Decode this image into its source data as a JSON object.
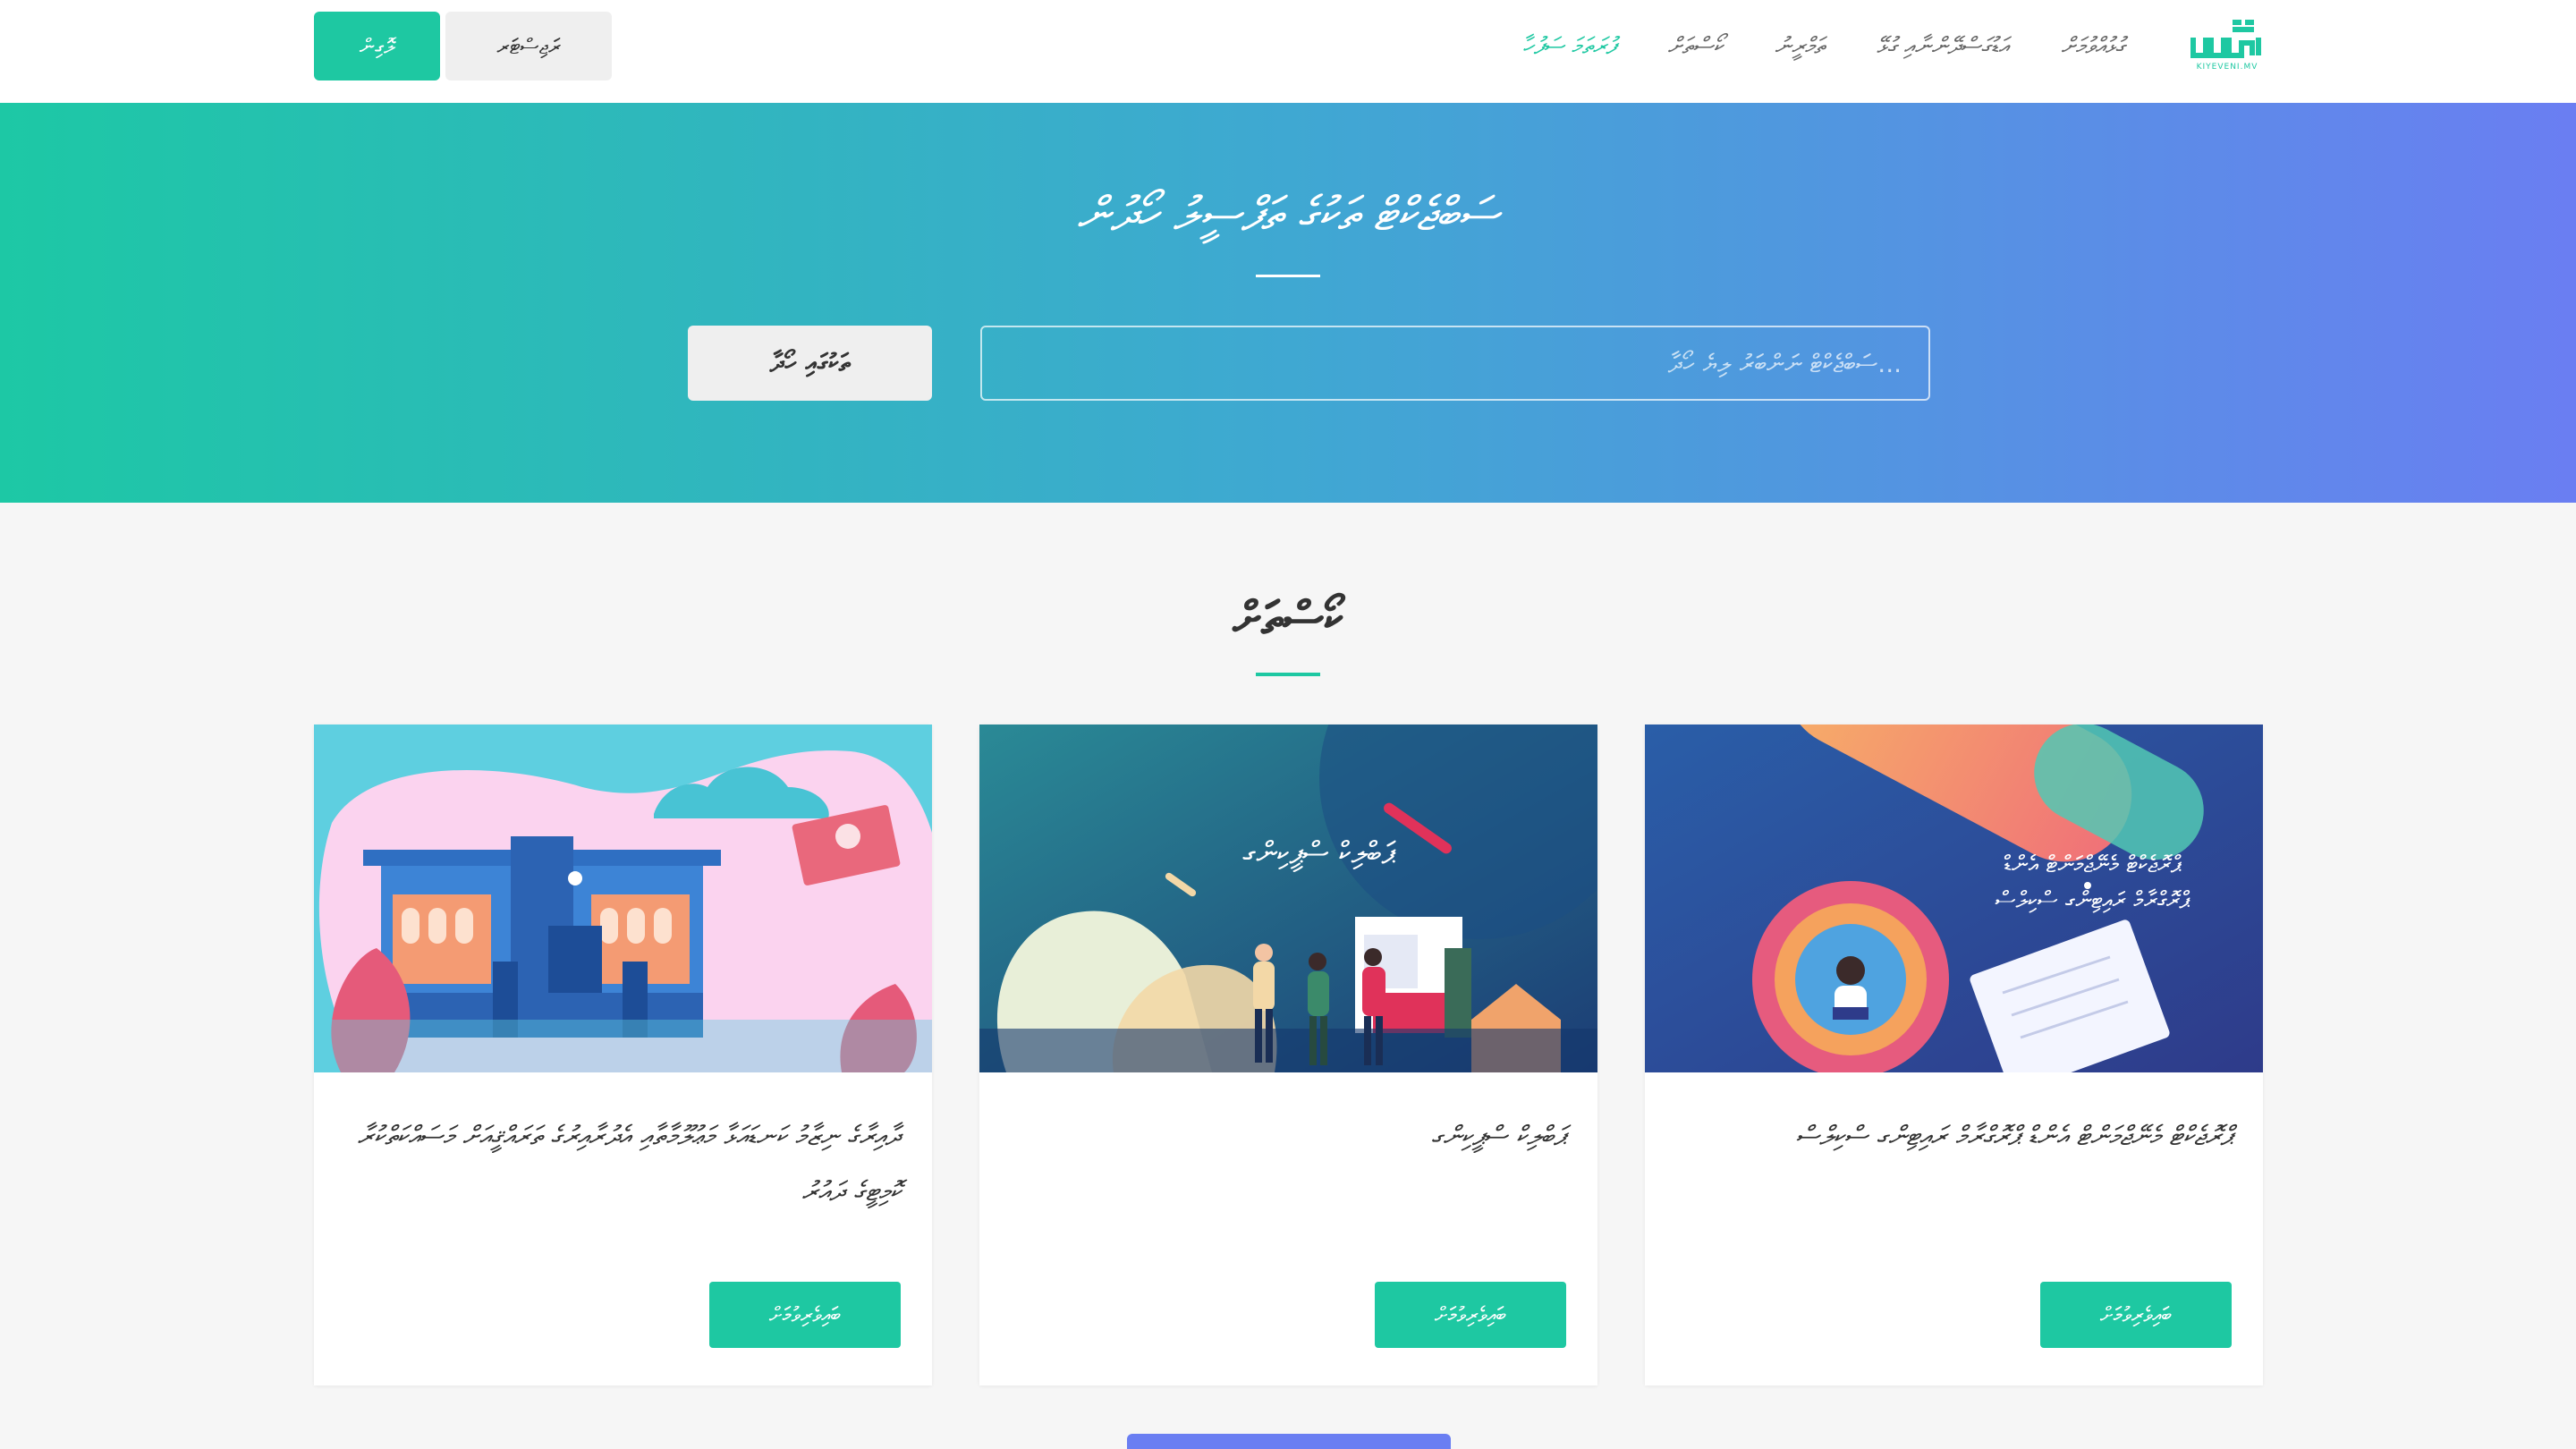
{
  "site": {
    "logo_text": "KIYEVENI.MV"
  },
  "nav": {
    "items": [
      {
        "label": "ފުރަތަމަ ސަފުހާ",
        "active": true
      },
      {
        "label": "ކޯސްތަށް"
      },
      {
        "label": "ތަމްރީނު"
      },
      {
        "label": "އަޑުގަސްދޭންނާއި ގުޅޭ"
      },
      {
        "label": "ގުޅުއްވުމަށް"
      }
    ],
    "login_label": "ލޮގިން",
    "register_label": "ރަޖިސްޓަރ"
  },
  "hero": {
    "title": "ސަބްޖެކްޓް ތަކުގެ ތަފްސީލު ހޯދުން",
    "search_placeholder": "...ސަބްޖެކްޓް ނަންބަރު ލިޔެ ހޯދާ",
    "search_button": "ތަކުގައި ހޯދާ"
  },
  "section": {
    "title": "ކޯސްތަށް"
  },
  "courses": [
    {
      "title": "ދާއިރާގެ ނިޒާމު ކަނޑައަޅާ މަޢުލޫމާތާއި އެދުރާއިރުގެ ތަރައްޤީއަށް މަސައްކަތްކުރާ ކޮމިޓީގެ ދައުރު",
      "button": "ބައިވެރިވުމަށް"
    },
    {
      "title": "ޕަބްލިކް ސްޕީކިންގ",
      "button": "ބައިވެރިވުމަށް"
    },
    {
      "title": "ޕްރޮޖެކްޓް މެނޭޖްމަންޓް އެންޑް ޕްރޮގްރާމް ރައިޓިންގ ސްކިލްސް",
      "button": "ބައިވެރިވުމަށް"
    }
  ],
  "image_texts": {
    "card2_overlay": "ޕަބްލިކް ސްޕީކިންގ",
    "card3_overlay_line1": "ޕްރޮޖެކްޓް މެނޭޖްމަންޓް އެންޑް",
    "card3_overlay_line2": "ޕްރޮގްރާމް ރައިޓިންގ ސްކިލްސް"
  },
  "colors": {
    "accent": "#1ec8a2",
    "hero_start": "#1dc8a5",
    "hero_end": "#6a7ef2"
  }
}
